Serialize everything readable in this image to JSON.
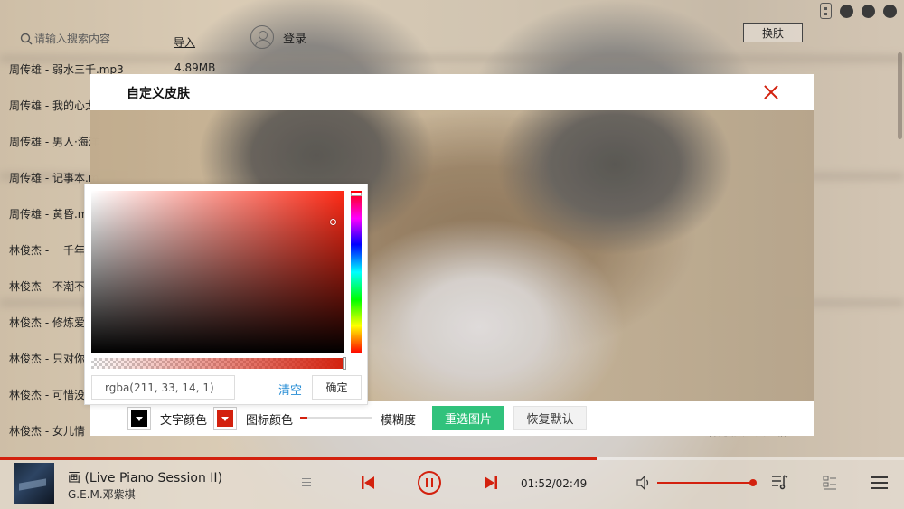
{
  "header": {
    "search_placeholder": "请输入搜索内容",
    "import_label": "导入",
    "login_label": "登录",
    "skin_button_label": "换肤"
  },
  "songs": [
    {
      "title": "周传雄 - 弱水三千.mp3",
      "size": "4.89MB"
    },
    {
      "title": "周传雄 - 我的心太"
    },
    {
      "title": "周传雄 - 男人·海洋"
    },
    {
      "title": "周传雄 - 记事本.m"
    },
    {
      "title": "周传雄 - 黄昏.m"
    },
    {
      "title": "林俊杰 - 一千年"
    },
    {
      "title": "林俊杰 - 不潮不"
    },
    {
      "title": "林俊杰 - 修炼爱"
    },
    {
      "title": "林俊杰 - 只对你"
    },
    {
      "title": "林俊杰 - 可惜没"
    },
    {
      "title": "林俊杰 - 女儿情"
    }
  ],
  "song_tail_text": "(林俊杰 - 女儿情",
  "dialog": {
    "title": "自定义皮肤",
    "text_color_label": "文字颜色",
    "icon_color_label": "图标颜色",
    "blur_label": "模糊度",
    "reselect_button": "重选图片",
    "reset_button": "恢复默认",
    "text_color": "#000000",
    "icon_color": "#d3210e",
    "blur_level": 0.1
  },
  "color_picker": {
    "value": "rgba(211, 33, 14, 1)",
    "clear_label": "清空",
    "ok_label": "确定"
  },
  "player": {
    "track_title": "画 (Live Piano Session II)",
    "artist": "G.E.M.邓紫棋",
    "time": "01:52/02:49",
    "progress": 0.66,
    "volume": 1.0,
    "accent_color": "#d3210e"
  }
}
